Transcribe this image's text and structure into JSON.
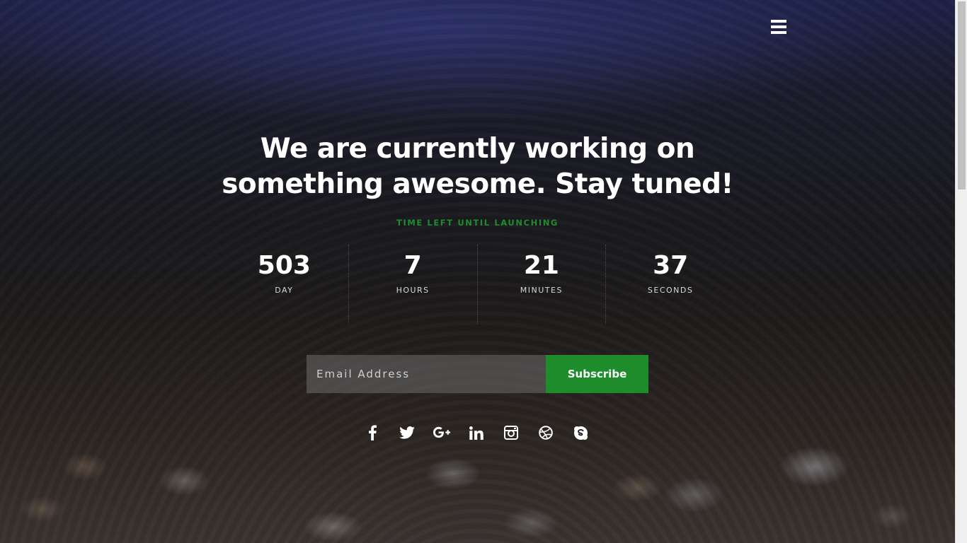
{
  "page": {
    "headline_line1": "We are currently working on",
    "headline_line2": "something awesome. Stay tuned!",
    "subtitle": "TIME LEFT UNTIL LAUNCHING"
  },
  "countdown": [
    {
      "value": "503",
      "label": "DAY"
    },
    {
      "value": "7",
      "label": "HOURS"
    },
    {
      "value": "21",
      "label": "MINUTES"
    },
    {
      "value": "37",
      "label": "SECONDS"
    }
  ],
  "subscribe": {
    "email_placeholder": "Email Address",
    "email_value": "",
    "button_label": "Subscribe"
  },
  "social": [
    "facebook-icon",
    "twitter-icon",
    "google-plus-icon",
    "linkedin-icon",
    "instagram-icon",
    "dribbble-icon",
    "skype-icon"
  ],
  "colors": {
    "accent": "#1f8c2c",
    "text": "#ffffff"
  },
  "menu": {
    "icon": "hamburger-menu-icon"
  }
}
